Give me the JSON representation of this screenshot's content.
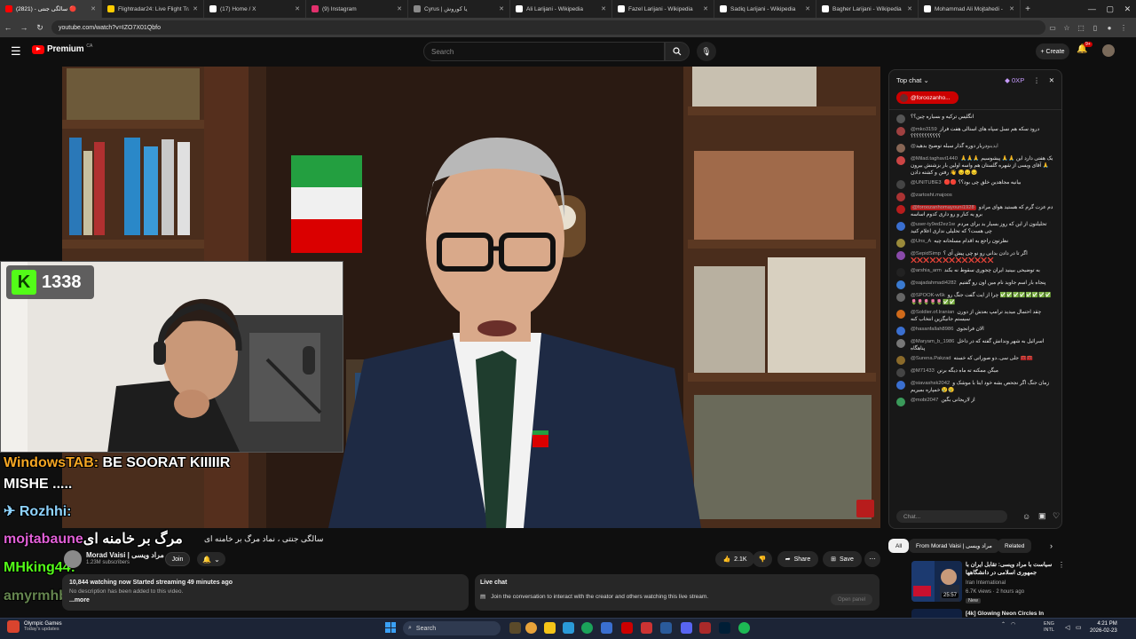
{
  "browser": {
    "tabs": [
      {
        "title": "سالگی جنتی - (2821) 🔴",
        "active": true,
        "favicon_color": "#ff0000"
      },
      {
        "title": "Flightradar24: Live Flight Tra",
        "active": false,
        "favicon_color": "#ffcc00"
      },
      {
        "title": "(17) Home / X",
        "active": false,
        "favicon_color": "#ffffff"
      },
      {
        "title": "(9) Instagram",
        "active": false,
        "favicon_color": "#e1306c"
      },
      {
        "title": "Cyrus | یا کوروش",
        "active": false,
        "favicon_color": "#8a8a8a"
      },
      {
        "title": "Ali Larijani - Wikipedia",
        "active": false,
        "favicon_color": "#ffffff"
      },
      {
        "title": "Fazel Larijani - Wikipedia",
        "active": false,
        "favicon_color": "#ffffff"
      },
      {
        "title": "Sadiq Larijani - Wikipedia",
        "active": false,
        "favicon_color": "#ffffff"
      },
      {
        "title": "Bagher Larijani - Wikipedia",
        "active": false,
        "favicon_color": "#ffffff"
      },
      {
        "title": "Mohammad Ali Mojtahedi - ",
        "active": false,
        "favicon_color": "#ffffff"
      }
    ],
    "new_tab": "+",
    "url": "youtube.com/watch?v=IZO7X01Qbfo"
  },
  "youtube": {
    "logo_text": "Premium",
    "logo_country": "CA",
    "search_placeholder": "Search",
    "create_label": "Create",
    "notifications_count": "9+"
  },
  "overlay": {
    "kick_count": "1338",
    "chat_lines": [
      {
        "name": "WindowsTAB:",
        "text": " BE SOORAT KIIIIIR",
        "color": "#f5a623"
      },
      {
        "name": "",
        "text": "MISHE .....",
        "color": "#ffffff"
      },
      {
        "name": "Rozhhi:",
        "text": "",
        "color": "#8fd4ff"
      },
      {
        "name": "mojtabaune",
        "text": "مرگ بر خامنه ای",
        "color": "#e05fd6"
      },
      {
        "name": "MHking44:",
        "text": "",
        "color": "#53fc18"
      },
      {
        "name": "amyrmhb",
        "text": "",
        "color": "#7aa35e"
      }
    ]
  },
  "video": {
    "title": "سالگی جنتی ، نماد مرگ بر خامنه ای"
  },
  "channel": {
    "name": "Morad Vaisi | مراد ویسی",
    "subscribers": "1.23M subscribers",
    "join_label": "Join",
    "likes": "2.1K",
    "share_label": "Share",
    "save_label": "Save"
  },
  "description": {
    "stats": "10,844 watching now  Started streaming 49 minutes ago",
    "text": "No description has been added to this video.",
    "more": "...more"
  },
  "live_chat_box": {
    "heading": "Live chat",
    "message": "Join the conversation to interact with the creator and others watching this live stream.",
    "open_panel": "Open panel"
  },
  "chat": {
    "header": "Top chat",
    "points": "0XP",
    "pinned": "@foroozanho...",
    "input_placeholder": "Chat...",
    "messages": [
      {
        "author": "",
        "text": "انگلیس ترکیه و بسیاره چین؟؟",
        "avatar": "#555555"
      },
      {
        "author": "@mko3159",
        "text": "درود سکه هم نسل سپاه های استالی هفت فراز ؟؟؟؟؟؟؟؟؟؟؟",
        "avatar": "#a04040"
      },
      {
        "author": "@ایدینو",
        "text": "دربار دوره گذار سبله توضیح بدهید",
        "avatar": "#886655"
      },
      {
        "author": "@Milad.taghavi1440",
        "text": "یک هفتی دارد این 🙏🙏 پیشوسیم 🙏🙏🙏🙏 آقای ویسی از شهره گلستان هم واسه اولین بار بزشنش بیرون رفتن و کشته دادن 👋 😔😔😔",
        "avatar": "#cc4444"
      },
      {
        "author": "@UNITUBE3",
        "text": "🔴🔴 بیانیه مجاهدین خلق چی بود؟؟",
        "avatar": "#444444"
      },
      {
        "author": "@zartosht.majoos",
        "text": "",
        "avatar": "#aa3333"
      },
      {
        "author": "@foroozanhomayouni1928",
        "text": "دم عزت گرم که هستید هوای مرادو برو یه کنار و رو داری کدوم اساسه",
        "avatar": "#b71c1c",
        "highlight": true
      },
      {
        "author": "@user-ty9ed2ez1w",
        "text": "تحلیلتون از این که روز بسیار بد برای مردم چی هست؟ که تحلیلی نداری اعلام کنید",
        "avatar": "#3a6fd0"
      },
      {
        "author": "@Uns_A",
        "text": "نظرتون راجع به اقدام مسلحانه چیه",
        "avatar": "#9a8a3a"
      },
      {
        "author": "@SepidSimp",
        "text": "اگر تا در دادن بدانی رو نو چی پیش آی ؟ ❌❌❌❌❌❌❌❌❌❌❌❌❌",
        "avatar": "#8a4aaa"
      },
      {
        "author": "@arshia_arm",
        "text": "به توضیحی ببینید ایران چجوری سقوط نه بکند",
        "avatar": "#222222"
      },
      {
        "author": "@sajadahmadi4282",
        "text": "پنجاه بار اسم جاوید نام مین اون رو گفتیم",
        "avatar": "#3a7ad0"
      },
      {
        "author": "@SPOOK-w6k",
        "text": "چرا از ایت گفت جنگ رو ✅✅✅✅✅✅✅✅ 🌷🌷🌷🌷🌷✅✅",
        "avatar": "#666666"
      },
      {
        "author": "@Soldier.of.Iranian",
        "text": "چقد احتمال میدید ترامپ بعدش از دورن سیستم جانیگزین انتخاب کنه",
        "avatar": "#d06a1a"
      },
      {
        "author": "@hasanfallah8986",
        "text": "الان فرانجوی",
        "avatar": "#3a6fd0"
      },
      {
        "author": "@Maryam_b_1986",
        "text": "اسرائیل به شهر وندانش گفته که در داخل پناهگاه",
        "avatar": "#777777"
      },
      {
        "author": "@Surena.Pakzad",
        "text": "جلی سی..دو صوراتی که خسته 🧰🧰",
        "avatar": "#8a6a2a"
      },
      {
        "author": "@M71433",
        "text": "میگن ممکنه ته ماه دیگه برنن",
        "avatar": "#444444"
      },
      {
        "author": "@siavashsk2042",
        "text": "زمان جنگ اگر نجحص بشه خود ایتا با موشک و خمپاره بمیریم 😢😢",
        "avatar": "#3a6fd0"
      },
      {
        "author": "@mobi2047",
        "text": "از لاریجانی بگین",
        "avatar": "#3a9a5a"
      }
    ]
  },
  "filters": {
    "chips": [
      "All",
      "From Morad Vaisi | مراد ویسی",
      "Related"
    ]
  },
  "recommendation": {
    "title": "سیاست با مراد ویسی: تقابل ایران با جمهوری اسلامی در دانشگاهها",
    "channel": "Iran International",
    "meta": "6.7K views · 2 hours ago",
    "badge": "New",
    "duration": "25:57",
    "next_title": "[4k] Glowing Neon Circles In"
  },
  "taskbar": {
    "weather_title": "Olympic Games",
    "weather_sub": "Today's updates",
    "search_label": "Search",
    "lang_top": "ENG",
    "lang_bottom": "INTL",
    "time": "4:21 PM",
    "date": "2026-02-23"
  }
}
